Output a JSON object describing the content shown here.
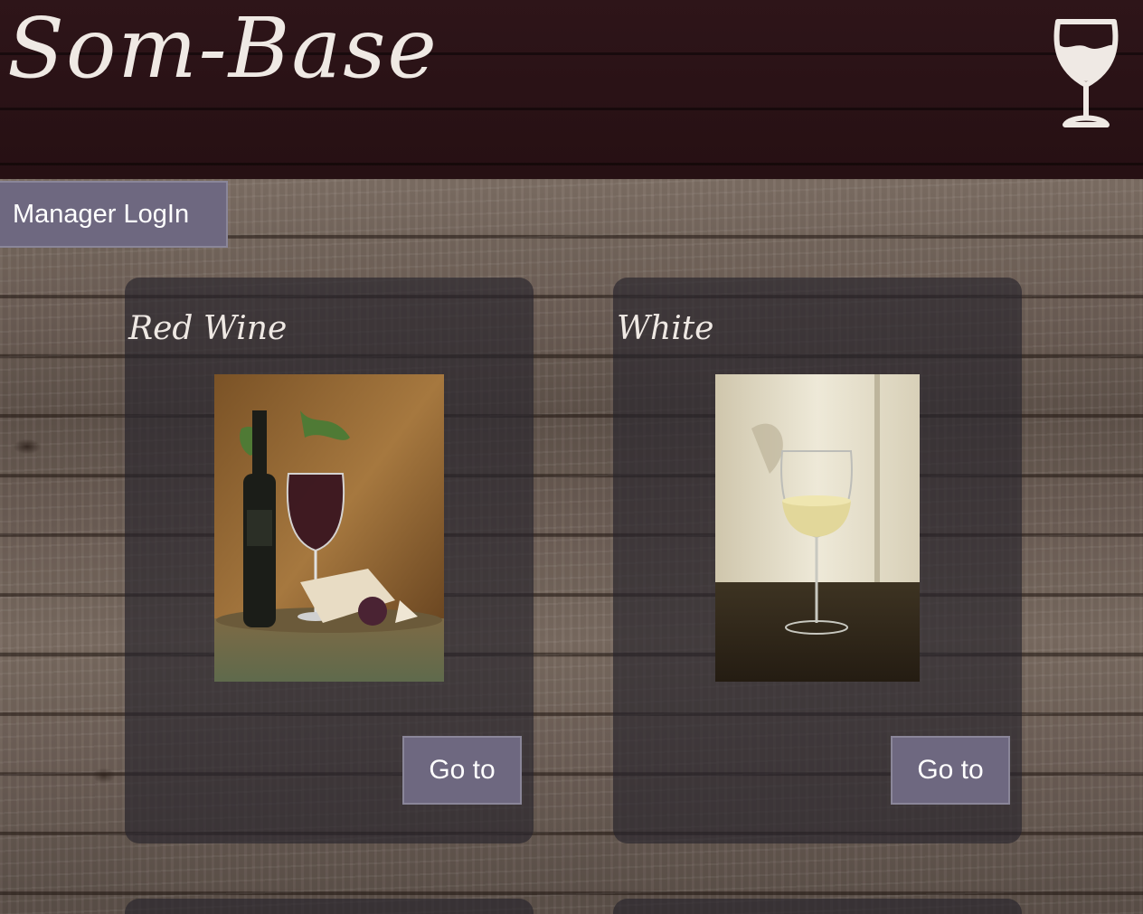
{
  "header": {
    "brand": "Som-Base",
    "logo_icon": "wine-glass-icon"
  },
  "manager_login": {
    "label": "Manager LogIn"
  },
  "categories": [
    {
      "title": "Red Wine",
      "image": "red-wine-bottle-glass-photo",
      "button_label": "Go to"
    },
    {
      "title": "White",
      "image": "white-wine-glass-photo",
      "button_label": "Go to"
    }
  ],
  "colors": {
    "header_bg": "#2a1216",
    "button_bg": "#6e6880",
    "card_bg": "#28242c",
    "text_light": "#efe9e4"
  }
}
